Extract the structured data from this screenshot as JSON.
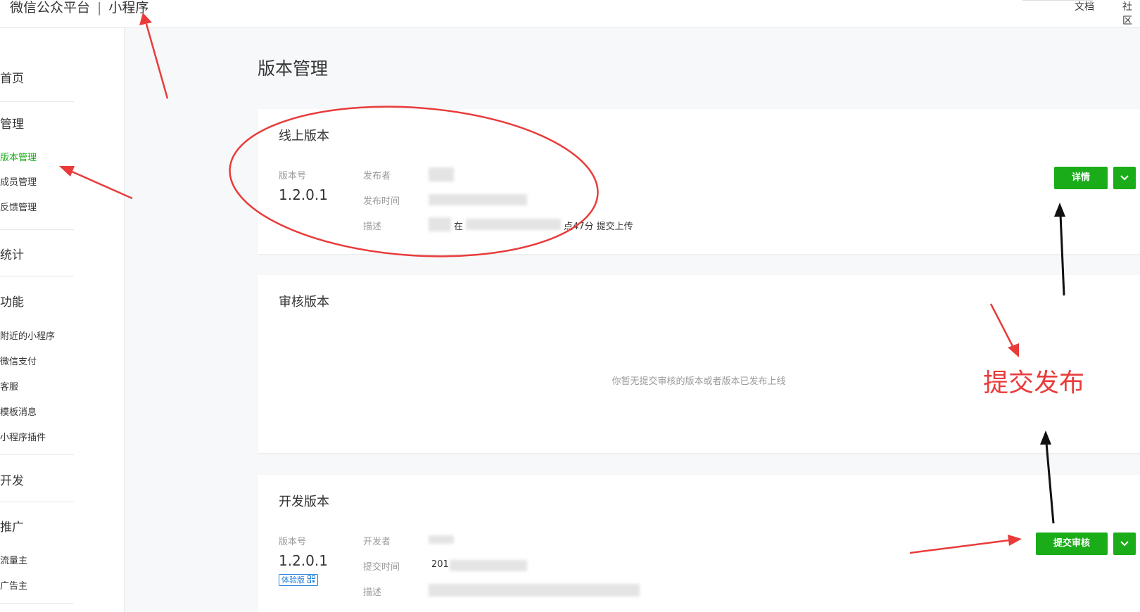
{
  "topbar": {
    "brand": "微信公众平台",
    "separator": "|",
    "product": "小程序",
    "links": [
      "文档",
      "社区"
    ]
  },
  "sidebar": {
    "groups": [
      {
        "label": "首页",
        "items": []
      },
      {
        "label": "管理",
        "items": [
          {
            "label": "版本管理",
            "active": true
          },
          {
            "label": "成员管理",
            "active": false
          },
          {
            "label": "反馈管理",
            "active": false
          }
        ]
      },
      {
        "label": "统计",
        "items": []
      },
      {
        "label": "功能",
        "items": [
          {
            "label": "附近的小程序",
            "active": false
          },
          {
            "label": "微信支付",
            "active": false
          },
          {
            "label": "客服",
            "active": false
          },
          {
            "label": "模板消息",
            "active": false
          },
          {
            "label": "小程序插件",
            "active": false
          }
        ]
      },
      {
        "label": "开发",
        "items": []
      },
      {
        "label": "推广",
        "items": [
          {
            "label": "流量主",
            "active": false
          },
          {
            "label": "广告主",
            "active": false
          }
        ]
      }
    ]
  },
  "main": {
    "title": "版本管理",
    "online": {
      "title": "线上版本",
      "version_label": "版本号",
      "version": "1.2.0.1",
      "publisher_label": "发布者",
      "time_label": "发布时间",
      "desc_label": "描述",
      "desc_prefix": "在",
      "desc_suffix": "点47分 提交上传",
      "detail_button": "详情"
    },
    "review": {
      "title": "审核版本",
      "empty": "你暂无提交审核的版本或者版本已发布上线"
    },
    "dev": {
      "title": "开发版本",
      "version_label": "版本号",
      "version": "1.2.0.1",
      "tag": "体验版",
      "developer_label": "开发者",
      "time_label": "提交时间",
      "time_prefix": "201",
      "desc_label": "描述",
      "submit_button": "提交审核"
    }
  },
  "annotation": {
    "text": "提交发布",
    "color": "#e93b3b"
  },
  "colors": {
    "accent": "#1aad19",
    "tag_blue": "#2782d7"
  }
}
